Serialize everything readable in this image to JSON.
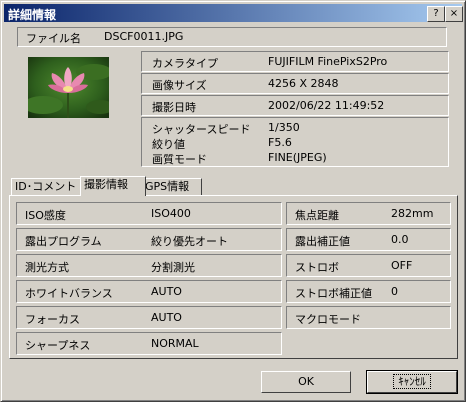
{
  "window": {
    "title": "詳細情報",
    "help_label": "?",
    "close_label": "×"
  },
  "file": {
    "label": "ファイル名",
    "value": "DSCF0011.JPG"
  },
  "info": [
    {
      "label": "カメラタイプ",
      "value": "FUJIFILM FinePixS2Pro"
    },
    {
      "label": "画像サイズ",
      "value": "4256 X 2848"
    },
    {
      "label": "撮影日時",
      "value": "2002/06/22 11:49:52"
    }
  ],
  "exposure": [
    {
      "label": "シャッタースピード",
      "value": "1/350"
    },
    {
      "label": "絞り値",
      "value": "F5.6"
    },
    {
      "label": "画質モード",
      "value": "FINE(JPEG)"
    }
  ],
  "tabs": [
    {
      "label": "ID･コメント"
    },
    {
      "label": "撮影情報"
    },
    {
      "label": "GPS情報"
    }
  ],
  "left_fields": [
    {
      "label": "ISO感度",
      "value": "ISO400"
    },
    {
      "label": "露出プログラム",
      "value": "絞り優先オート"
    },
    {
      "label": "測光方式",
      "value": "分割測光"
    },
    {
      "label": "ホワイトバランス",
      "value": "AUTO"
    },
    {
      "label": "フォーカス",
      "value": "AUTO"
    },
    {
      "label": "シャープネス",
      "value": "NORMAL"
    }
  ],
  "right_fields": [
    {
      "label": "焦点距離",
      "value": "282mm"
    },
    {
      "label": "露出補正値",
      "value": "0.0"
    },
    {
      "label": "ストロボ",
      "value": "OFF"
    },
    {
      "label": "ストロボ補正値",
      "value": "0"
    },
    {
      "label": "マクロモード",
      "value": ""
    }
  ],
  "buttons": {
    "ok": "OK",
    "cancel": "ｷｬﾝｾﾙ"
  }
}
